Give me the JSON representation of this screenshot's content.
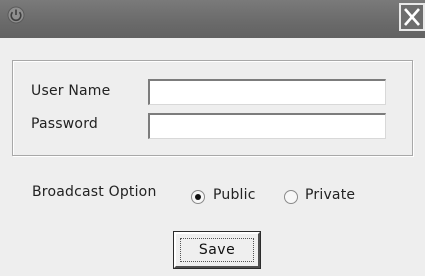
{
  "window": {
    "app_icon": "app-power-icon",
    "close_icon": "close-x-icon",
    "close_char": "✕"
  },
  "form": {
    "username_label": "User Name",
    "username_value": "",
    "password_label": "Password",
    "password_value": ""
  },
  "broadcast": {
    "label": "Broadcast Option",
    "options": [
      {
        "label": "Public",
        "selected": true
      },
      {
        "label": "Private",
        "selected": false
      }
    ]
  },
  "actions": {
    "save_label": "Save"
  },
  "colors": {
    "titlebar": "#6a6a6a",
    "dialog_bg": "#eeeeee"
  }
}
